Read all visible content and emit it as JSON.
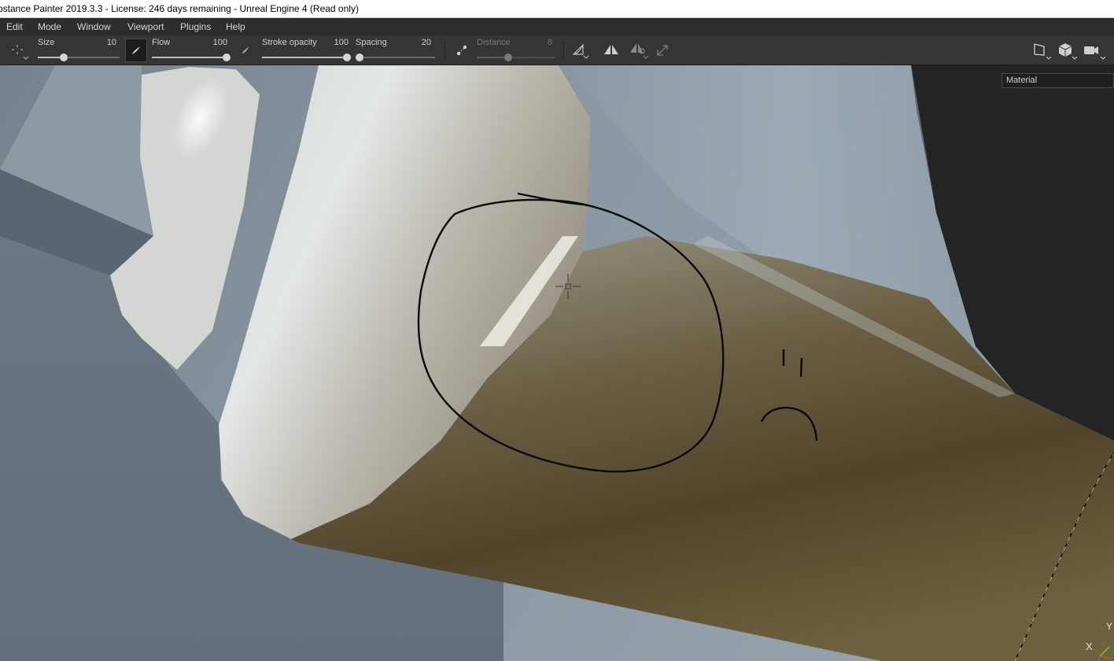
{
  "window": {
    "title": "bstance Painter 2019.3.3 - License: 246 days remaining - Unreal Engine 4 (Read only)"
  },
  "menu": {
    "items": [
      "Edit",
      "Mode",
      "Window",
      "Viewport",
      "Plugins",
      "Help"
    ]
  },
  "toolbar": {
    "size": {
      "label": "Size",
      "value": "10",
      "level": 0.32
    },
    "flow": {
      "label": "Flow",
      "value": "100",
      "level": 1.0
    },
    "stroke_opacity": {
      "label": "Stroke opacity",
      "value": "100",
      "level": 1.0
    },
    "spacing": {
      "label": "Spacing",
      "value": "20",
      "level": 0.05
    },
    "distance": {
      "label": "Distance",
      "value": "8",
      "level": 0.4
    }
  },
  "viewport": {
    "channel_select": {
      "value": "Material"
    },
    "gizmo": {
      "x_label": "X",
      "y_label": "Y"
    }
  },
  "icons": [
    "transform-icon",
    "brush-icon",
    "lazy-mouse-icon",
    "stroke-preset-icon",
    "symmetry-icon",
    "symmetry-settings-icon",
    "transform-gizmo-icon",
    "view-2d-icon",
    "view-3d-icon",
    "camera-icon"
  ],
  "colors": {
    "menubar_bg": "#2d2d2d",
    "toolbar_bg": "#353535",
    "viewport_bg": "#242424"
  }
}
